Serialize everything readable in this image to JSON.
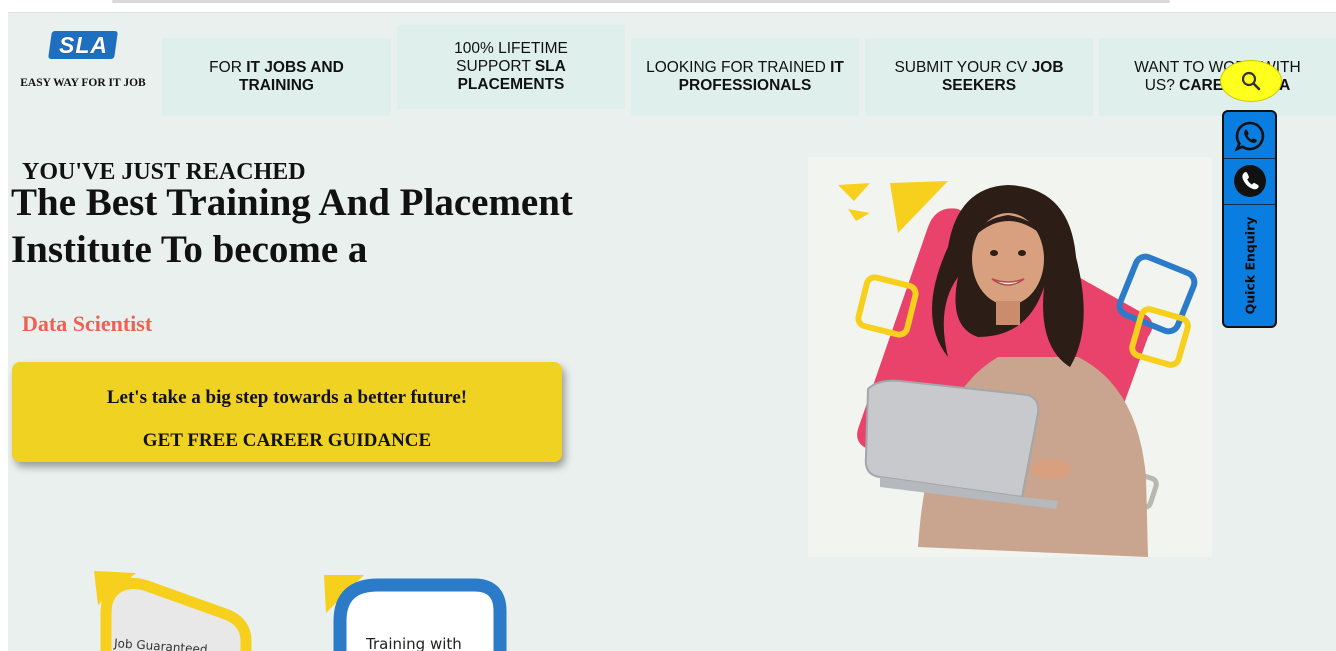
{
  "logo": {
    "brand": "SLA",
    "tagline": "EASY WAY FOR IT JOB"
  },
  "nav": [
    {
      "pre": "FOR ",
      "bold": "IT JOBS AND TRAINING",
      "post": ""
    },
    {
      "pre": "100% LIFETIME SUPPORT ",
      "bold": "SLA PLACEMENTS",
      "post": ""
    },
    {
      "pre": "LOOKING FOR TRAINED ",
      "bold": "IT PROFESSIONALS",
      "post": ""
    },
    {
      "pre": "SUBMIT YOUR CV ",
      "bold": "JOB SEEKERS",
      "post": ""
    },
    {
      "pre": "WANT TO WORK WITH US? ",
      "bold": "CAREERS SLA",
      "post": ""
    }
  ],
  "hero": {
    "kicker": "YOU'VE JUST REACHED",
    "headline": "The Best Training And Placement Institute To become a",
    "role": "Data Scientist",
    "cta_line1": "Let's take a big step towards a better future!",
    "cta_line2": "GET FREE CAREER GUIDANCE"
  },
  "badges": [
    {
      "text": "Job Guaranteed"
    },
    {
      "text": "Training with"
    }
  ],
  "floating": {
    "search_icon": "search-icon",
    "whatsapp_icon": "whatsapp-icon",
    "phone_icon": "phone-icon",
    "quick_enquiry": "Quick Enquiry"
  },
  "colors": {
    "page_bg": "#eaf0ee",
    "nav_bg": "#dff0ec",
    "cta_bg": "#f0d223",
    "role_text": "#ef5f52",
    "side_panel": "#0a7de0",
    "search_bg": "#ffff1e",
    "logo_blue": "#1f6fc0",
    "accent_pink": "#e9436b",
    "accent_yellow": "#f6d01d",
    "accent_blue": "#2b7bc8"
  }
}
